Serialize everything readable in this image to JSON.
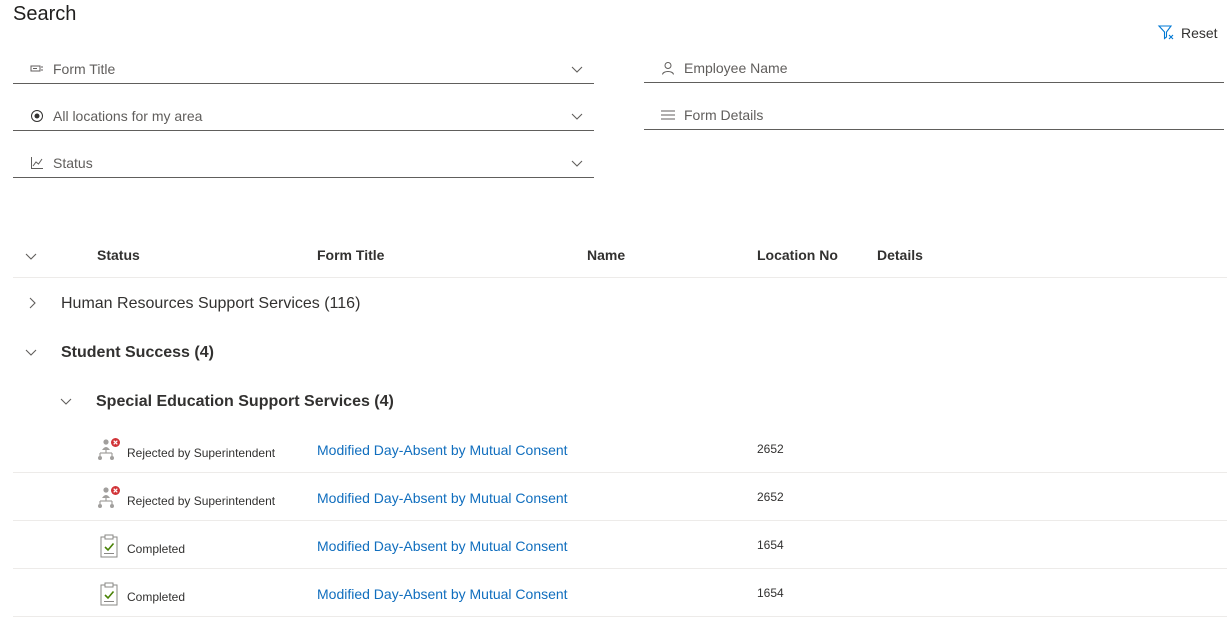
{
  "page": {
    "title": "Search"
  },
  "toolbar": {
    "reset_label": "Reset"
  },
  "filters": {
    "form_title": {
      "label": "Form Title",
      "icon": "form-icon"
    },
    "location": {
      "label": "All locations for my area",
      "icon": "radio-target-icon"
    },
    "status": {
      "label": "Status",
      "icon": "chart-icon"
    },
    "employee_name": {
      "label": "Employee Name",
      "icon": "person-icon"
    },
    "form_details": {
      "label": "Form Details",
      "icon": "lines-icon"
    }
  },
  "grid": {
    "columns": {
      "status": "Status",
      "form_title": "Form Title",
      "name": "Name",
      "location_no": "Location No",
      "details": "Details"
    },
    "groups": [
      {
        "label": "Human Resources Support Services (116)",
        "expanded": false
      },
      {
        "label": "Student Success (4)",
        "expanded": true,
        "subgroups": [
          {
            "label": "Special Education Support Services (4)",
            "expanded": true
          }
        ]
      }
    ],
    "rows": [
      {
        "status": "Rejected by Superintendent",
        "status_icon": "rejected-approval-icon",
        "form_title": "Modified Day-Absent by Mutual Consent",
        "location_no": "2652"
      },
      {
        "status": "Rejected by Superintendent",
        "status_icon": "rejected-approval-icon",
        "form_title": "Modified Day-Absent by Mutual Consent",
        "location_no": "2652"
      },
      {
        "status": "Completed",
        "status_icon": "completed-checklist-icon",
        "form_title": "Modified Day-Absent by Mutual Consent",
        "location_no": "1654"
      },
      {
        "status": "Completed",
        "status_icon": "completed-checklist-icon",
        "form_title": "Modified Day-Absent by Mutual Consent",
        "location_no": "1654"
      }
    ]
  },
  "colors": {
    "link": "#106ebe",
    "reject": "#d13438",
    "complete": "#498205",
    "border": "#edebe9"
  }
}
